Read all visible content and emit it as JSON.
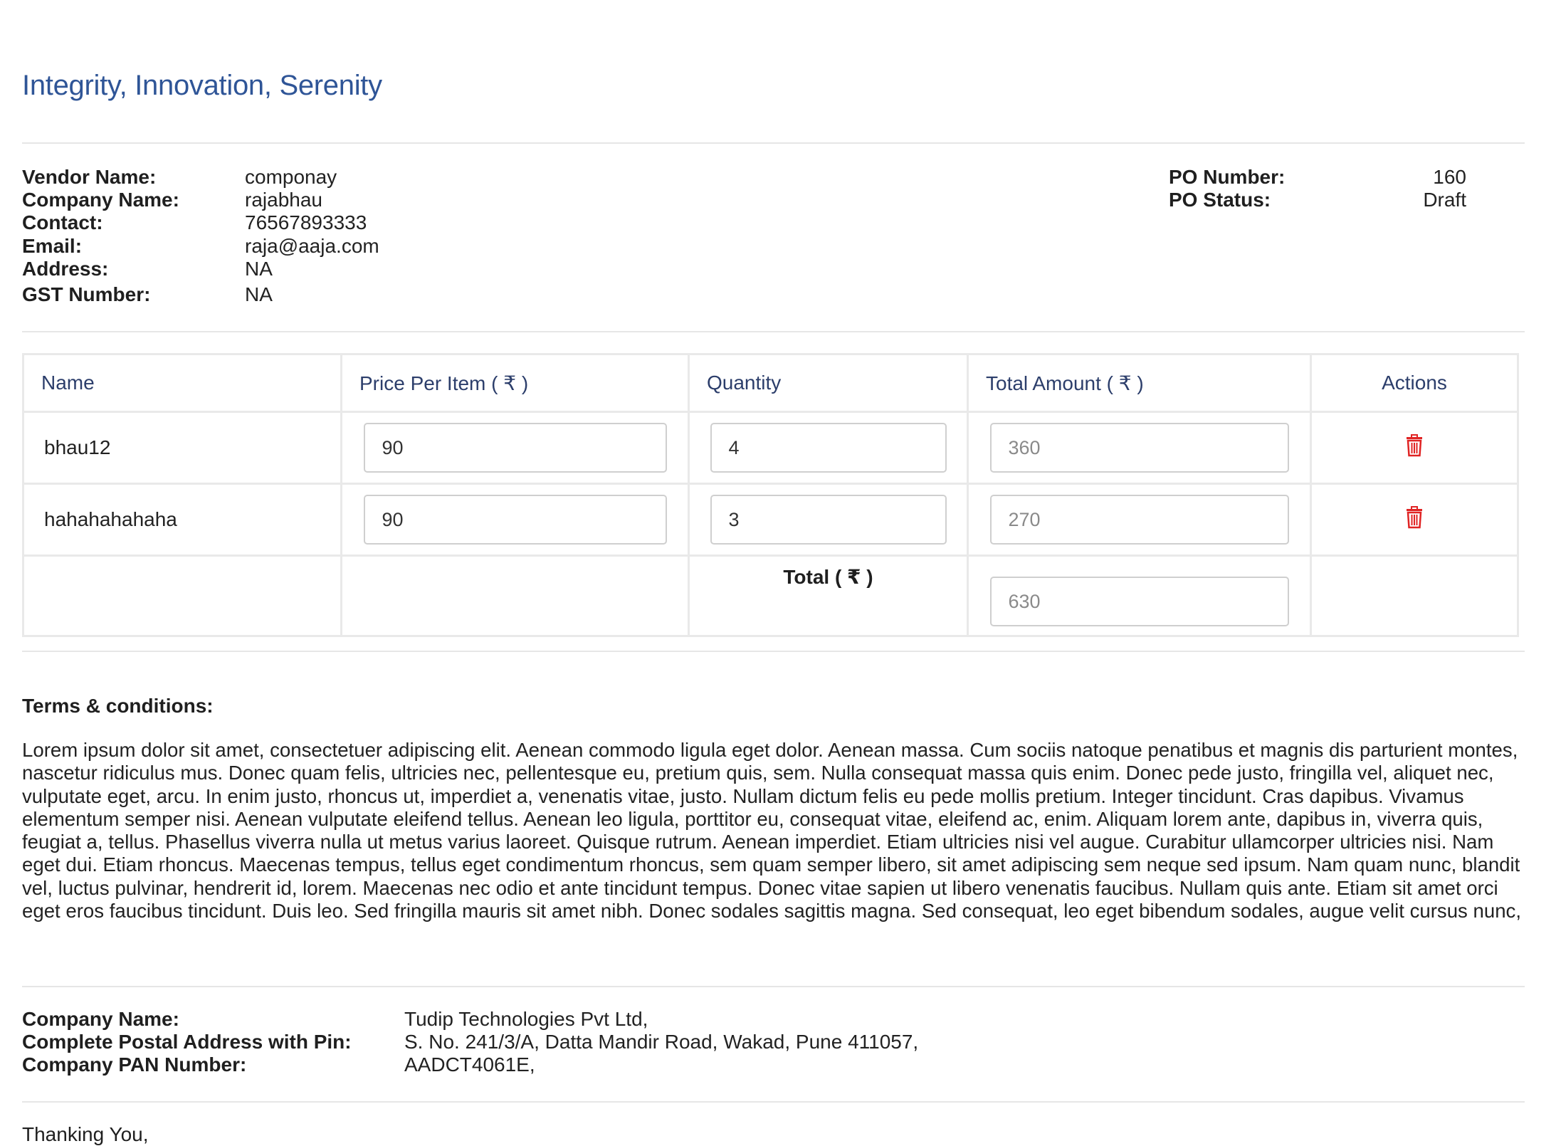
{
  "header": {
    "tagline": "Integrity, Innovation, Serenity"
  },
  "vendor": {
    "labels": {
      "vendor_name": "Vendor Name:",
      "company_name": "Company Name:",
      "contact": "Contact:",
      "email": "Email:",
      "address": "Address:",
      "gst_number": "GST Number:"
    },
    "values": {
      "vendor_name": "componay",
      "company_name": "rajabhau",
      "contact": "76567893333",
      "email": "raja@aaja.com",
      "address": "NA",
      "gst_number": "NA"
    }
  },
  "po": {
    "number_label": "PO Number:",
    "number": "160",
    "status_label": "PO Status:",
    "status": "Draft"
  },
  "items_table": {
    "headers": {
      "name": "Name",
      "price": "Price Per Item ( ₹ )",
      "quantity": "Quantity",
      "total_amount": "Total Amount ( ₹ )",
      "actions": "Actions"
    },
    "rows": [
      {
        "name": "bhau12",
        "price": "90",
        "quantity": "4",
        "total": "360"
      },
      {
        "name": "hahahahahaha",
        "price": "90",
        "quantity": "3",
        "total": "270"
      }
    ],
    "total_label": "Total ( ₹ )",
    "grand_total": "630",
    "delete_icon_color": "#e02424"
  },
  "terms": {
    "title": "Terms & conditions:",
    "text": "Lorem ipsum dolor sit amet, consectetuer adipiscing elit. Aenean commodo ligula eget dolor. Aenean massa. Cum sociis natoque penatibus et magnis dis parturient montes, nascetur ridiculus mus. Donec quam felis, ultricies nec, pellentesque eu, pretium quis, sem. Nulla consequat massa quis enim. Donec pede justo, fringilla vel, aliquet nec, vulputate eget, arcu. In enim justo, rhoncus ut, imperdiet a, venenatis vitae, justo. Nullam dictum felis eu pede mollis pretium. Integer tincidunt. Cras dapibus. Vivamus elementum semper nisi. Aenean vulputate eleifend tellus. Aenean leo ligula, porttitor eu, consequat vitae, eleifend ac, enim. Aliquam lorem ante, dapibus in, viverra quis, feugiat a, tellus. Phasellus viverra nulla ut metus varius laoreet. Quisque rutrum. Aenean imperdiet. Etiam ultricies nisi vel augue. Curabitur ullamcorper ultricies nisi. Nam eget dui. Etiam rhoncus. Maecenas tempus, tellus eget condimentum rhoncus, sem quam semper libero, sit amet adipiscing sem neque sed ipsum. Nam quam nunc, blandit vel, luctus pulvinar, hendrerit id, lorem. Maecenas nec odio et ante tincidunt tempus. Donec vitae sapien ut libero venenatis faucibus. Nullam quis ante. Etiam sit amet orci eget eros faucibus tincidunt. Duis leo. Sed fringilla mauris sit amet nibh. Donec sodales sagittis magna. Sed consequat, leo eget bibendum sodales, augue velit cursus nunc,"
  },
  "company": {
    "labels": {
      "name": "Company Name:",
      "address": "Complete Postal Address with Pin:",
      "pan": "Company PAN Number:"
    },
    "values": {
      "name": "Tudip Technologies Pvt Ltd,",
      "address": "S. No. 241/3/A, Datta Mandir Road, Wakad, Pune 411057,",
      "pan": "AADCT4061E,"
    }
  },
  "closing": {
    "text": "Thanking You,"
  }
}
